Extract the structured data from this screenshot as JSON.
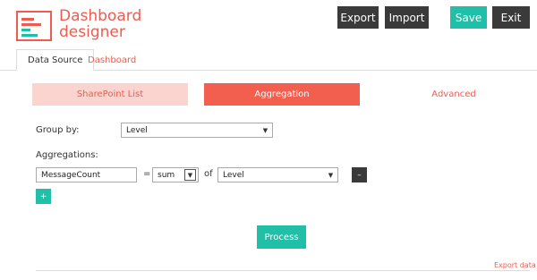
{
  "header": {
    "logo_line1": "Dashboard",
    "logo_line2": "designer",
    "export_label": "Export",
    "import_label": "Import",
    "save_label": "Save",
    "exit_label": "Exit"
  },
  "tabs": [
    {
      "label": "Data Source",
      "active": true
    },
    {
      "label": "Dashboard",
      "active": false
    }
  ],
  "steps": [
    {
      "label": "SharePoint List"
    },
    {
      "label": "Aggregation"
    },
    {
      "label": "Advanced"
    }
  ],
  "form": {
    "group_by_label": "Group by:",
    "group_by_value": "Level",
    "aggregations_label": "Aggregations:",
    "agg_name_value": "MessageCount",
    "equals": "=",
    "func_value": "sum",
    "of_label": "of",
    "field_value": "Level",
    "remove_label": "–",
    "add_label": "+"
  },
  "process_label": "Process",
  "export_data_label": "Export data",
  "colors": {
    "accent": "#f05b4f",
    "teal": "#1fbfa8",
    "dark": "#3a3a3a"
  }
}
